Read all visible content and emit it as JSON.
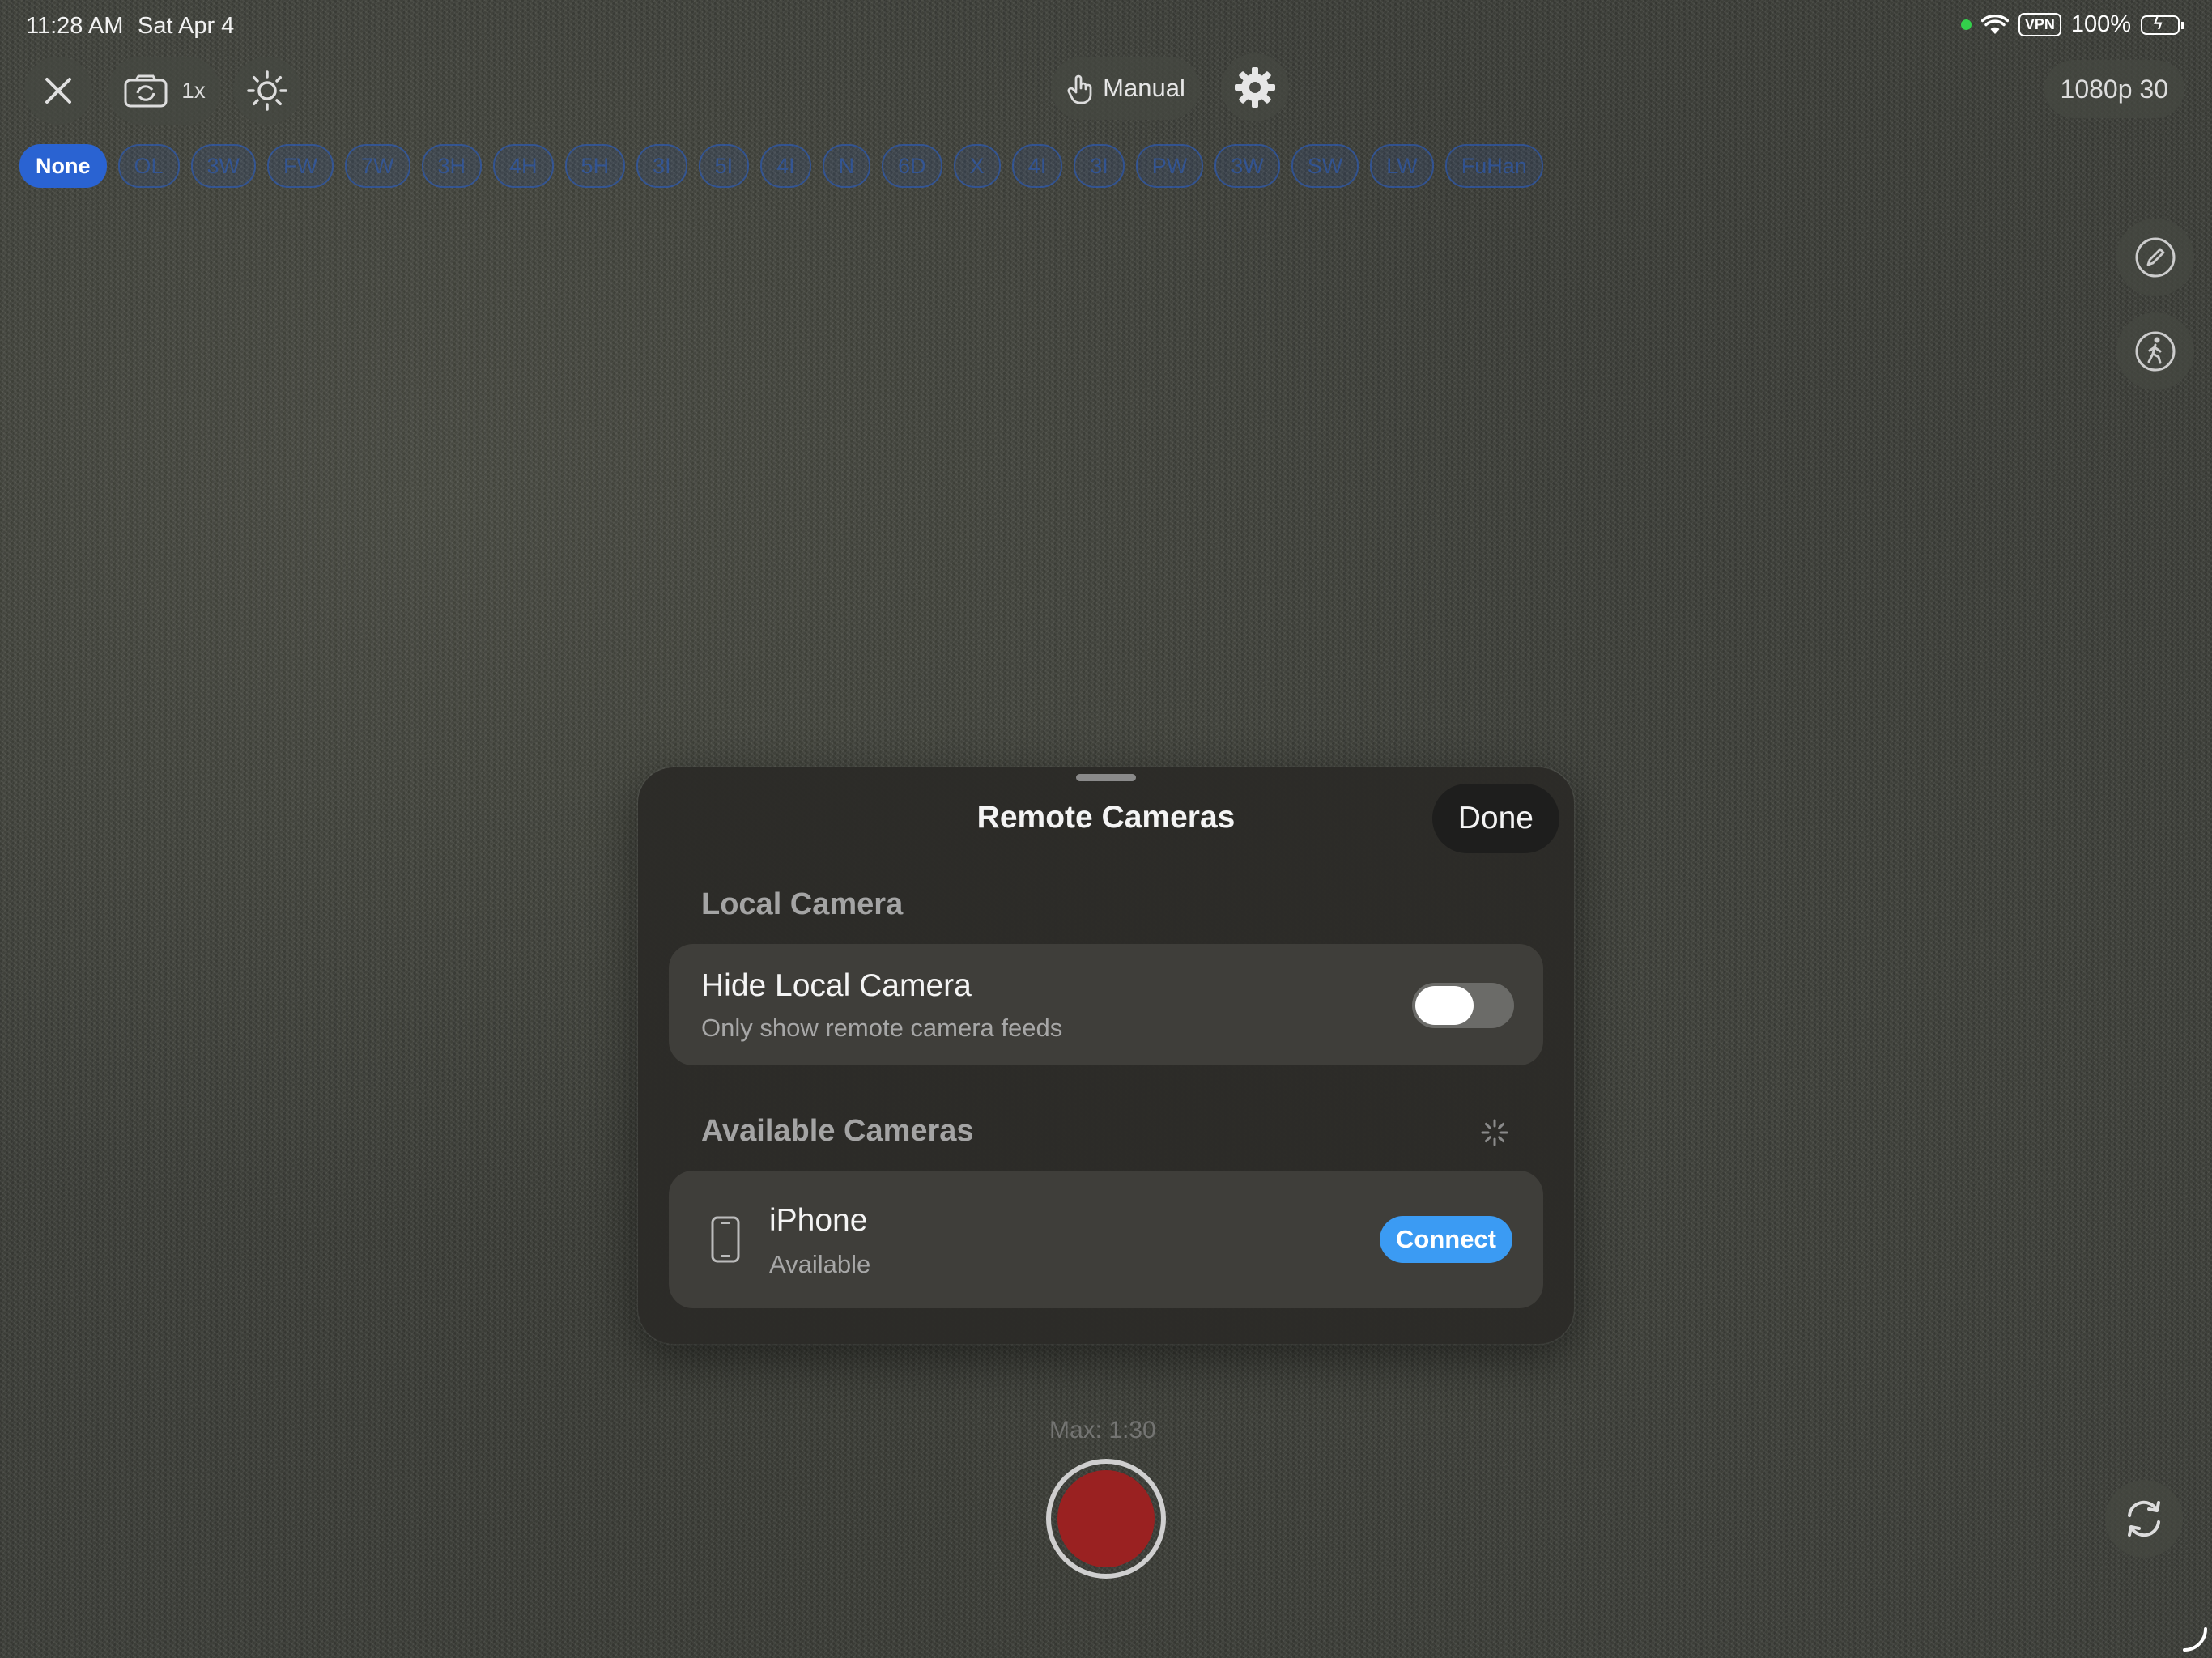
{
  "status_bar": {
    "time": "11:28 AM",
    "date": "Sat Apr 4",
    "vpn": "VPN",
    "battery": "100%"
  },
  "top_bar": {
    "zoom": "1x",
    "mode_label": "Manual",
    "resolution": "1080p 30"
  },
  "filter_chips": [
    "None",
    "OL",
    "3W",
    "FW",
    "7W",
    "3H",
    "4H",
    "5H",
    "3I",
    "5I",
    "4I",
    "N",
    "6D",
    "X",
    "4I",
    "3I",
    "PW",
    "3W",
    "SW",
    "LW",
    "FuHan"
  ],
  "active_chip": "None",
  "record": {
    "max_label": "Max: 1:30"
  },
  "sheet": {
    "title": "Remote Cameras",
    "done_label": "Done",
    "local_section": "Local Camera",
    "hide_local_title": "Hide Local Camera",
    "hide_local_sub": "Only show remote camera feeds",
    "hide_local_on": false,
    "available_section": "Available Cameras",
    "devices": [
      {
        "name": "iPhone",
        "status": "Available",
        "action": "Connect"
      }
    ]
  },
  "colors": {
    "accent_blue": "#3b9bf3",
    "chip_active": "#2a63d2",
    "record_red": "#9a2121",
    "status_green": "#33d04b"
  }
}
